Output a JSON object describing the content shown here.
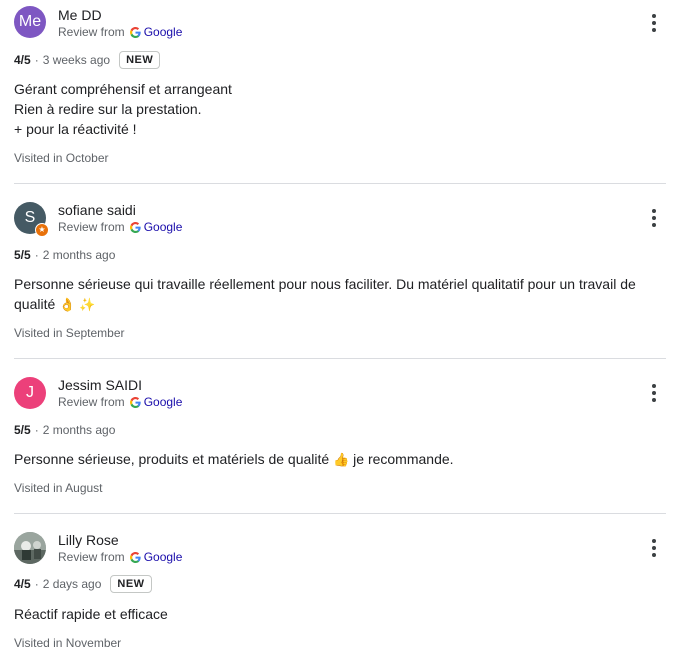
{
  "source": {
    "prefix": "Review from",
    "provider": "Google"
  },
  "reviews": [
    {
      "initials": "Me",
      "avatar_color": "#7e57c2",
      "name": "Me DD",
      "rating": "4/5",
      "sep": "·",
      "time": "3 weeks ago",
      "new_label": "NEW",
      "text_lines": [
        "Gérant compréhensif et arrangeant",
        "Rien à redire sur la prestation.",
        "+ pour la réactivité !"
      ],
      "visited": "Visited in October"
    },
    {
      "initials": "S",
      "avatar_color": "#455a64",
      "badge_icon": "★",
      "name": "sofiane saidi",
      "rating": "5/5",
      "sep": "·",
      "time": "2 months ago",
      "text_lines": [
        "Personne sérieuse qui travaille réellement pour nous faciliter. Du matériel qualitatif pour un travail de",
        "qualité"
      ],
      "emojis": [
        "👌",
        "✨"
      ],
      "visited": "Visited in September"
    },
    {
      "initials": "J",
      "avatar_color": "#ec407a",
      "name": "Jessim SAIDI",
      "rating": "5/5",
      "sep": "·",
      "time": "2 months ago",
      "text_before": "Personne sérieuse, produits et matériels de qualité",
      "emoji": "👍",
      "text_after": "je recommande.",
      "visited": "Visited in August"
    },
    {
      "name": "Lilly Rose",
      "rating": "4/5",
      "sep": "·",
      "time": "2 days ago",
      "new_label": "NEW",
      "text_lines": [
        "Réactif rapide et efficace"
      ],
      "visited": "Visited in November"
    }
  ]
}
